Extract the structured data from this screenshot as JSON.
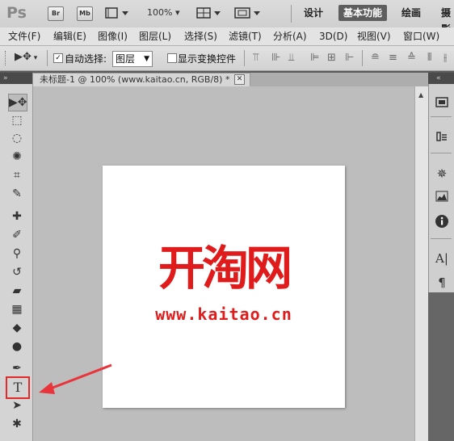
{
  "app": {
    "logo": "Ps",
    "bridge_label": "Br",
    "minibridge_label": "Mb",
    "zoom_level": "100%"
  },
  "workspaces": [
    {
      "label": "设计"
    },
    {
      "label": "基本功能",
      "active": true
    },
    {
      "label": "绘画"
    },
    {
      "label": "摄影"
    }
  ],
  "menu": [
    "文件(F)",
    "编辑(E)",
    "图像(I)",
    "图层(L)",
    "选择(S)",
    "滤镜(T)",
    "分析(A)",
    "3D(D)",
    "视图(V)",
    "窗口(W)"
  ],
  "options_bar": {
    "auto_select_label": "自动选择:",
    "auto_select_checked": true,
    "auto_select_value": "图层",
    "show_transform_label": "显示变换控件",
    "show_transform_checked": false
  },
  "document": {
    "tab_title": "未标题-1 @ 100% (www.kaitao.cn, RGB/8) *",
    "close_glyph": "✕",
    "canvas_title": "开淘网",
    "canvas_url": "www.kaitao.cn",
    "text_color": "#e01b1b"
  },
  "tools": [
    {
      "name": "move-tool-icon",
      "glyph": "⇲"
    },
    {
      "name": "marquee-tool-icon",
      "glyph": "⬚"
    },
    {
      "name": "lasso-tool-icon",
      "glyph": "◌"
    },
    {
      "name": "quick-select-tool-icon",
      "glyph": "✺"
    },
    {
      "name": "crop-tool-icon",
      "glyph": "⌗"
    },
    {
      "name": "eyedropper-tool-icon",
      "glyph": "✎"
    },
    {
      "name": "healing-brush-tool-icon",
      "glyph": "✚"
    },
    {
      "name": "brush-tool-icon",
      "glyph": "✐"
    },
    {
      "name": "clone-stamp-tool-icon",
      "glyph": "⚲"
    },
    {
      "name": "history-brush-tool-icon",
      "glyph": "↺"
    },
    {
      "name": "eraser-tool-icon",
      "glyph": "▰"
    },
    {
      "name": "gradient-tool-icon",
      "glyph": "▦"
    },
    {
      "name": "blur-tool-icon",
      "glyph": "💧"
    },
    {
      "name": "dodge-tool-icon",
      "glyph": "●"
    },
    {
      "name": "pen-tool-icon",
      "glyph": "✒"
    },
    {
      "name": "type-tool-icon",
      "glyph": "T",
      "highlighted": true
    },
    {
      "name": "path-select-tool-icon",
      "glyph": "➤"
    },
    {
      "name": "shape-tool-icon",
      "glyph": "✱"
    }
  ],
  "right_panel_icons": [
    "layers-panel-icon",
    "history-panel-icon",
    "navigator-panel-icon",
    "histogram-panel-icon",
    "info-panel-icon",
    "character-panel-icon",
    "paragraph-panel-icon"
  ],
  "colors": {
    "accent_highlight": "#e32a2a",
    "annotation_arrow": "#e8343a",
    "active_workspace_bg": "#5e5e5e"
  }
}
